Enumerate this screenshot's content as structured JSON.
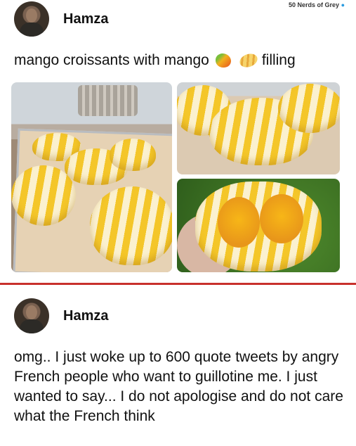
{
  "watermark": {
    "text": "50 Nerds of Grey",
    "dot": "●"
  },
  "post": {
    "username": "Hamza",
    "caption_before": "mango croissants with mango",
    "caption_after": "filling",
    "emojis": [
      "mango-emoji",
      "croissant-emoji"
    ]
  },
  "reply": {
    "username": "Hamza",
    "text": "omg.. I just woke up to 600 quote tweets by angry French people who want to guillotine me. I just wanted to say... I do not apologise and do not care what the French think"
  },
  "colors": {
    "divider": "#c8302c",
    "watermark_dot": "#2b9be0"
  }
}
